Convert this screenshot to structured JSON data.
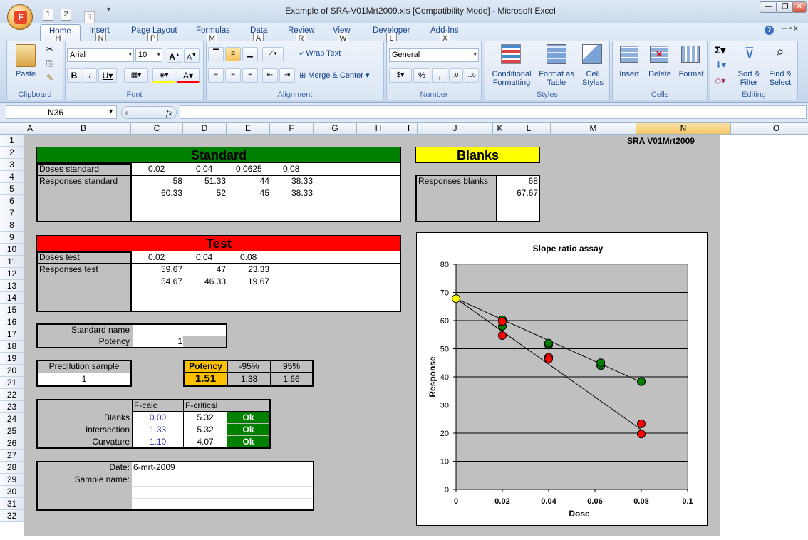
{
  "window": {
    "title": "Example of SRA-V01Mrt2009.xls  [Compatibility Mode] - Microsoft Excel",
    "office_button": "F",
    "qat_keytips": [
      "1",
      "2",
      "3"
    ]
  },
  "ribbon": {
    "tabs": [
      {
        "label": "Home",
        "key": "H"
      },
      {
        "label": "Insert",
        "key": "N"
      },
      {
        "label": "Page Layout",
        "key": "P"
      },
      {
        "label": "Formulas",
        "key": "M"
      },
      {
        "label": "Data",
        "key": "A"
      },
      {
        "label": "Review",
        "key": "R"
      },
      {
        "label": "View",
        "key": "W"
      },
      {
        "label": "Developer",
        "key": "L"
      },
      {
        "label": "Add-Ins",
        "key": "X"
      }
    ],
    "groups": {
      "clipboard": "Clipboard",
      "font": "Font",
      "alignment": "Alignment",
      "number": "Number",
      "styles": "Styles",
      "cells": "Cells",
      "editing": "Editing"
    },
    "paste": "Paste",
    "font_name": "Arial",
    "font_size": "10",
    "wrap_text": "Wrap Text",
    "merge_center": "Merge & Center",
    "number_format": "General",
    "conditional_formatting": "Conditional Formatting",
    "format_as_table": "Format as Table",
    "cell_styles": "Cell Styles",
    "insert": "Insert",
    "delete": "Delete",
    "format": "Format",
    "sort_filter": "Sort & Filter",
    "find_select": "Find & Select"
  },
  "formula_bar": {
    "name_box": "N36",
    "fx": "fx",
    "value": ""
  },
  "columns": [
    "A",
    "B",
    "C",
    "D",
    "E",
    "F",
    "G",
    "H",
    "I",
    "J",
    "K",
    "L",
    "M",
    "N",
    "O"
  ],
  "rows": [
    "1",
    "2",
    "3",
    "4",
    "5",
    "6",
    "7",
    "8",
    "9",
    "10",
    "11",
    "12",
    "13",
    "14",
    "15",
    "16",
    "17",
    "18",
    "19",
    "20",
    "21",
    "22",
    "23",
    "24",
    "25",
    "26",
    "27",
    "28",
    "29",
    "30",
    "31",
    "32"
  ],
  "sheet": {
    "version": "SRA V01Mrt2009",
    "standard": {
      "title": "Standard",
      "doses_label": "Doses standard",
      "doses": [
        "0.02",
        "0.04",
        "0.0625",
        "0.08"
      ],
      "responses_label": "Responses standard",
      "resp1": [
        "58",
        "51.33",
        "44",
        "38.33"
      ],
      "resp2": [
        "60.33",
        "52",
        "45",
        "38.33"
      ]
    },
    "blanks": {
      "title": "Blanks",
      "label": "Responses blanks",
      "values": [
        "68",
        "67.67"
      ]
    },
    "test": {
      "title": "Test",
      "doses_label": "Doses test",
      "doses": [
        "0.02",
        "0.04",
        "0.08"
      ],
      "responses_label": "Responses test",
      "resp1": [
        "59.67",
        "47",
        "23.33"
      ],
      "resp2": [
        "54.67",
        "46.33",
        "19.67"
      ]
    },
    "standard_name_label": "Standard name",
    "potency_label": "Potency",
    "potency_value": "1",
    "predilution_label": "Predilution sample",
    "predilution_value": "1",
    "result": {
      "potency_label": "Potency",
      "lo_label": "-95%",
      "hi_label": "95%",
      "potency": "1.51",
      "lo": "1.38",
      "hi": "1.66"
    },
    "ftable": {
      "h1": "F-calc",
      "h2": "F-critical",
      "rows": [
        {
          "label": "Blanks",
          "fcalc": "0.00",
          "fcrit": "5.32",
          "status": "Ok"
        },
        {
          "label": "Intersection",
          "fcalc": "1.33",
          "fcrit": "5.32",
          "status": "Ok"
        },
        {
          "label": "Curvature",
          "fcalc": "1.10",
          "fcrit": "4.07",
          "status": "Ok"
        }
      ]
    },
    "date_label": "Date:",
    "date_value": "6-mrt-2009",
    "sample_name_label": "Sample name:"
  },
  "chart_data": {
    "type": "scatter",
    "title": "Slope ratio assay",
    "xlabel": "Dose",
    "ylabel": "Response",
    "xlim": [
      0,
      0.1
    ],
    "ylim": [
      0,
      80
    ],
    "xticks": [
      "0",
      "0.02",
      "0.04",
      "0.06",
      "0.08",
      "0.1"
    ],
    "yticks": [
      "0",
      "10",
      "20",
      "30",
      "40",
      "50",
      "60",
      "70",
      "80"
    ],
    "grid": "horizontal",
    "series": [
      {
        "color": "#008000",
        "points": [
          [
            0.02,
            58
          ],
          [
            0.02,
            60.33
          ],
          [
            0.04,
            51.33
          ],
          [
            0.04,
            52
          ],
          [
            0.0625,
            44
          ],
          [
            0.0625,
            45
          ],
          [
            0.08,
            38.33
          ],
          [
            0.08,
            38.33
          ]
        ]
      },
      {
        "color": "#ff0000",
        "points": [
          [
            0.02,
            59.67
          ],
          [
            0.02,
            54.67
          ],
          [
            0.04,
            47
          ],
          [
            0.04,
            46.33
          ],
          [
            0.08,
            23.33
          ],
          [
            0.08,
            19.67
          ]
        ]
      },
      {
        "color": "#ffff00",
        "points": [
          [
            0,
            67.8
          ]
        ]
      }
    ],
    "lines": [
      {
        "from": [
          0,
          67.8
        ],
        "to": [
          0.08,
          38.1
        ]
      },
      {
        "from": [
          0,
          67.8
        ],
        "to": [
          0.08,
          21.2
        ]
      }
    ]
  }
}
